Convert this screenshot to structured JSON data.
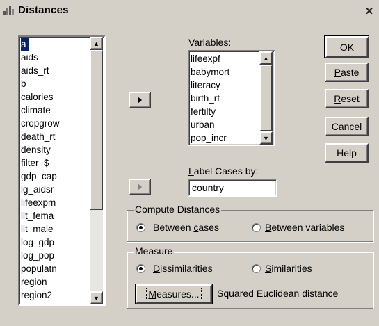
{
  "window": {
    "title": "Distances",
    "close_glyph": "✕"
  },
  "source_list": {
    "selected": "a",
    "items": [
      "a",
      "aids",
      "aids_rt",
      "b",
      "calories",
      "climate",
      "cropgrow",
      "death_rt",
      "density",
      "filter_$",
      "gdp_cap",
      "lg_aidsr",
      "lifeexpm",
      "lit_fema",
      "lit_male",
      "log_gdp",
      "log_pop",
      "populatn",
      "region",
      "region2"
    ]
  },
  "variables": {
    "label_prefix": "",
    "label_mnemonic": "V",
    "label_rest": "ariables:",
    "items": [
      "lifeexpf",
      "babymort",
      "literacy",
      "birth_rt",
      "fertilty",
      "urban",
      "pop_incr"
    ]
  },
  "label_cases": {
    "label_mnemonic": "L",
    "label_rest": "abel Cases by:",
    "value": "country"
  },
  "buttons": {
    "ok": "OK",
    "paste_m": "P",
    "paste_r": "aste",
    "reset_m": "R",
    "reset_r": "eset",
    "cancel": "Cancel",
    "help": "Help"
  },
  "compute": {
    "legend": "Compute Distances",
    "opt1_a": "Between ",
    "opt1_m": "c",
    "opt1_b": "ases",
    "opt2_m": "B",
    "opt2_b": "etween variables",
    "selected": "Between cases"
  },
  "measure": {
    "legend": "Measure",
    "opt1_m": "D",
    "opt1_b": "issimilarities",
    "opt2_m": "S",
    "opt2_b": "imilarities",
    "selected": "Dissimilarities",
    "button_m": "M",
    "button_b": "easures...",
    "current": "Squared Euclidean distance"
  },
  "icons": {
    "title": "spss-icon",
    "move_right": "right-triangle-icon",
    "scroll_up": "up-triangle-icon",
    "scroll_down": "down-triangle-icon"
  }
}
